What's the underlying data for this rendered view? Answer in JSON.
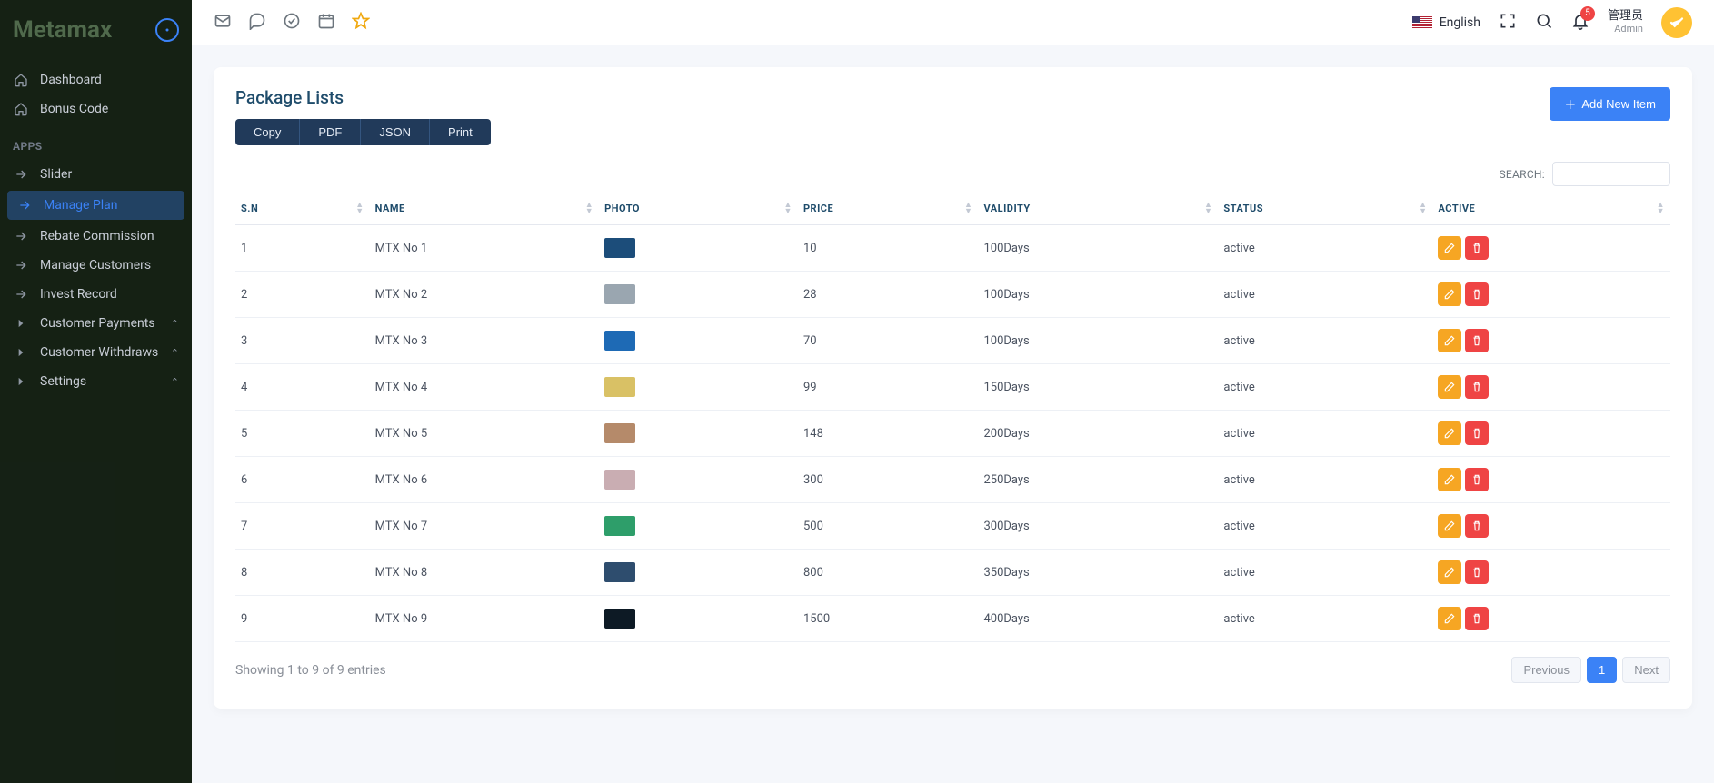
{
  "brand": "Metamax",
  "sidebar": {
    "items_top": [
      {
        "label": "Dashboard",
        "icon": "home"
      },
      {
        "label": "Bonus Code",
        "icon": "home"
      }
    ],
    "section_label": "APPS",
    "items_apps": [
      {
        "label": "Slider",
        "icon": "arrow",
        "expandable": false,
        "active": false
      },
      {
        "label": "Manage Plan",
        "icon": "arrow",
        "expandable": false,
        "active": true
      },
      {
        "label": "Rebate Commission",
        "icon": "arrow",
        "expandable": false,
        "active": false
      },
      {
        "label": "Manage Customers",
        "icon": "arrow",
        "expandable": false,
        "active": false
      },
      {
        "label": "Invest Record",
        "icon": "arrow",
        "expandable": false,
        "active": false
      },
      {
        "label": "Customer Payments",
        "icon": "caret",
        "expandable": true,
        "active": false
      },
      {
        "label": "Customer Withdraws",
        "icon": "caret",
        "expandable": true,
        "active": false
      },
      {
        "label": "Settings",
        "icon": "caret",
        "expandable": true,
        "active": false
      }
    ]
  },
  "topbar": {
    "language": "English",
    "notification_count": "5",
    "user_name": "管理员",
    "user_role": "Admin"
  },
  "card": {
    "title": "Package Lists",
    "add_button": "Add New Item",
    "export": [
      "Copy",
      "PDF",
      "JSON",
      "Print"
    ],
    "search_label": "SEARCH:",
    "search_value": "",
    "columns": [
      "S.N",
      "NAME",
      "PHOTO",
      "PRICE",
      "VALIDITY",
      "STATUS",
      "ACTIVE"
    ],
    "rows": [
      {
        "sn": "1",
        "name": "MTX No 1",
        "thumb": "#1c4d7a",
        "price": "10",
        "validity": "100Days",
        "status": "active"
      },
      {
        "sn": "2",
        "name": "MTX No 2",
        "thumb": "#9aa6b0",
        "price": "28",
        "validity": "100Days",
        "status": "active"
      },
      {
        "sn": "3",
        "name": "MTX No 3",
        "thumb": "#1e6ab5",
        "price": "70",
        "validity": "100Days",
        "status": "active"
      },
      {
        "sn": "4",
        "name": "MTX No 4",
        "thumb": "#d9c165",
        "price": "99",
        "validity": "150Days",
        "status": "active"
      },
      {
        "sn": "5",
        "name": "MTX No 5",
        "thumb": "#b58a6a",
        "price": "148",
        "validity": "200Days",
        "status": "active"
      },
      {
        "sn": "6",
        "name": "MTX No 6",
        "thumb": "#c9adb2",
        "price": "300",
        "validity": "250Days",
        "status": "active"
      },
      {
        "sn": "7",
        "name": "MTX No 7",
        "thumb": "#2e9e6a",
        "price": "500",
        "validity": "300Days",
        "status": "active"
      },
      {
        "sn": "8",
        "name": "MTX No 8",
        "thumb": "#2e4d6e",
        "price": "800",
        "validity": "350Days",
        "status": "active"
      },
      {
        "sn": "9",
        "name": "MTX No 9",
        "thumb": "#0d1a25",
        "price": "1500",
        "validity": "400Days",
        "status": "active"
      }
    ],
    "entries_info": "Showing 1 to 9 of 9 entries",
    "pager": {
      "prev": "Previous",
      "pages": [
        "1"
      ],
      "next": "Next",
      "current": "1"
    }
  }
}
